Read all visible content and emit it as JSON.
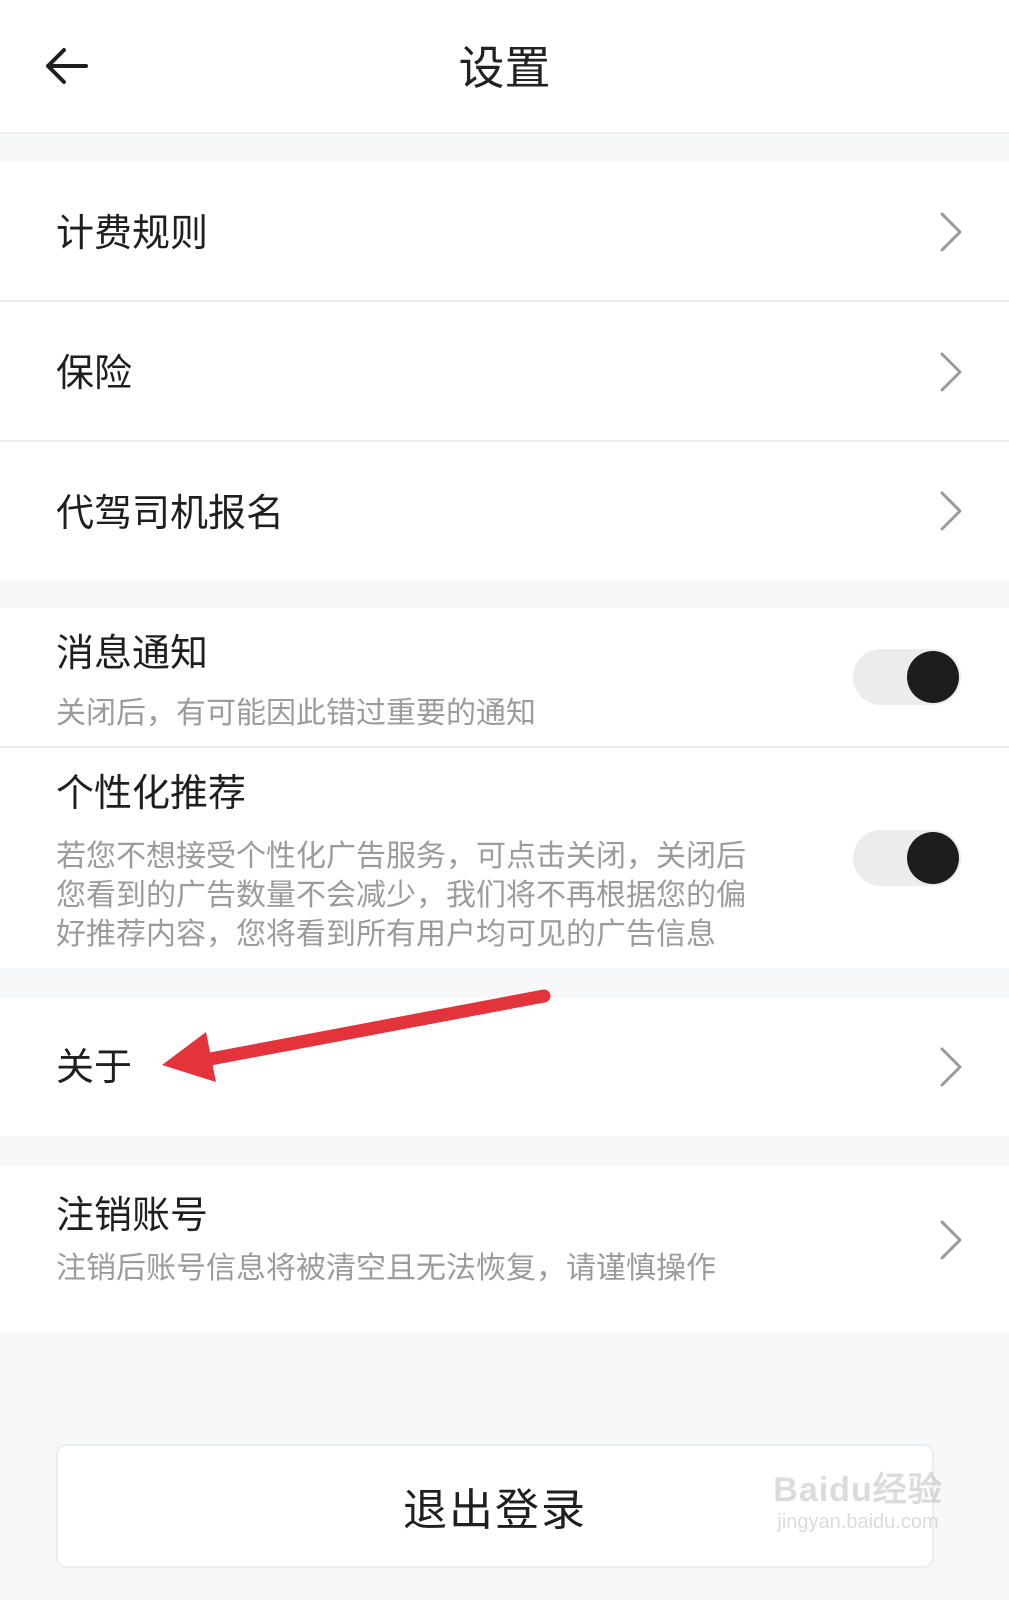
{
  "header": {
    "title": "设置",
    "back_icon": "arrow-left-icon"
  },
  "groups": [
    {
      "items": [
        {
          "title": "计费规则",
          "control": "chevron"
        },
        {
          "title": "保险",
          "control": "chevron"
        },
        {
          "title": "代驾司机报名",
          "control": "chevron"
        }
      ]
    },
    {
      "items": [
        {
          "title": "消息通知",
          "subtitle": "关闭后，有可能因此错过重要的通知",
          "control": "toggle",
          "toggle_on": true
        },
        {
          "title": "个性化推荐",
          "subtitle_lines": [
            "若您不想接受个性化广告服务，可点击关闭，关闭后",
            "您看到的广告数量不会减少，我们将不再根据您的偏",
            "好推荐内容，您将看到所有用户均可见的广告信息"
          ],
          "control": "toggle",
          "toggle_on": true
        }
      ]
    },
    {
      "items": [
        {
          "title": "关于",
          "control": "chevron"
        }
      ]
    },
    {
      "items": [
        {
          "title": "注销账号",
          "subtitle": "注销后账号信息将被清空且无法恢复，请谨慎操作",
          "control": "chevron"
        }
      ]
    }
  ],
  "logout": {
    "label": "退出登录"
  },
  "annotation": {
    "arrow_color": "#e3343b"
  },
  "watermark": {
    "logo": "Baidu经验",
    "url": "jingyan.baidu.com"
  },
  "colors": {
    "background": "#f7f8fa",
    "card": "#ffffff",
    "toggle_track": "#ececec",
    "toggle_knob": "#1d1d1d",
    "secondary_text": "#9b9b9b"
  }
}
